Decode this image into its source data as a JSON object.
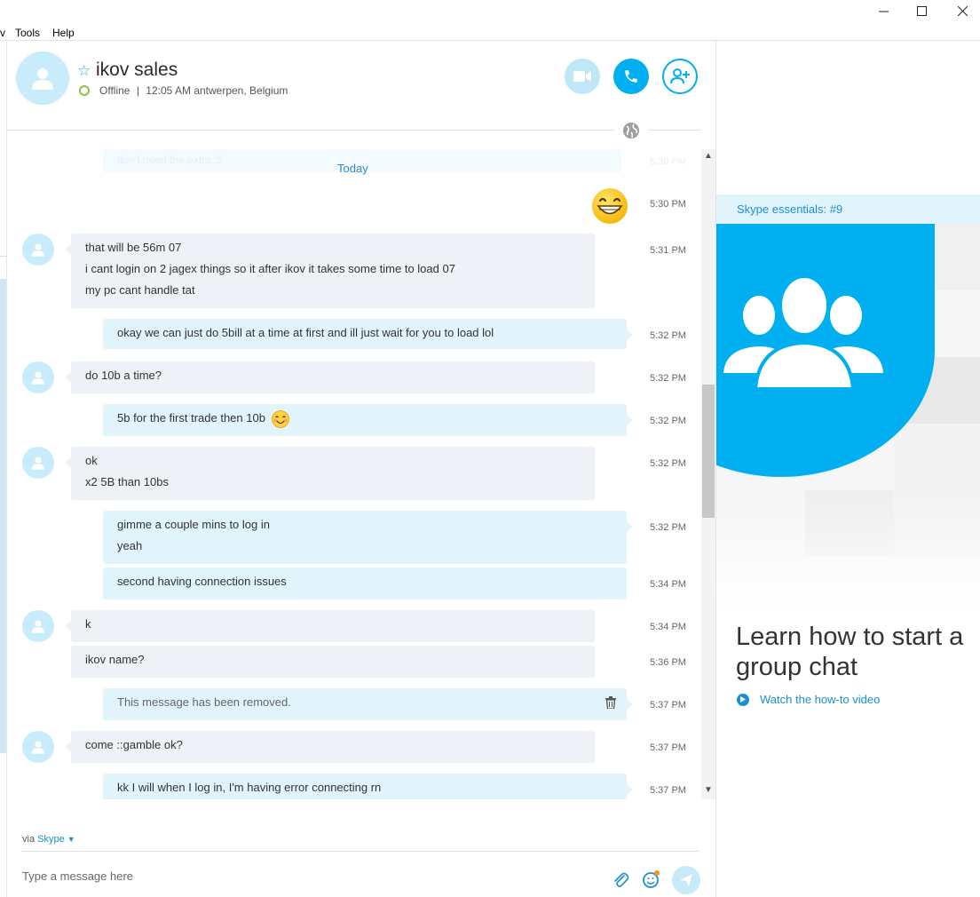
{
  "window": {
    "menu": [
      "v",
      "Tools",
      "Help"
    ],
    "controls": [
      "minimize",
      "maximize",
      "close"
    ]
  },
  "header": {
    "contact_name": "ikov sales",
    "status": "Offline",
    "status_separator": "|",
    "local_time": "12:05 AM antwerpen, Belgium",
    "icons": [
      "star-icon",
      "video-call-icon",
      "phone-icon",
      "add-people-icon",
      "globe-icon"
    ]
  },
  "chat": {
    "ghost_message": "don't need the extra .5",
    "ghost_time": "5:30 PM",
    "date_separator": "Today",
    "messages": [
      {
        "dir": "out",
        "emoji": "grin",
        "time": "5:30 PM"
      },
      {
        "dir": "in",
        "lines": [
          "that will be 56m 07",
          "i cant login on 2 jagex things so it after ikov it takes some time to load 07",
          "my pc cant handle tat"
        ],
        "time": "5:31 PM"
      },
      {
        "dir": "out",
        "lines": [
          "okay we can just do 5bill at a time at first and ill just wait for you to load lol"
        ],
        "time": "5:32 PM"
      },
      {
        "dir": "in",
        "lines": [
          "do 10b a time?"
        ],
        "time": "5:32 PM"
      },
      {
        "dir": "out",
        "lines": [
          "5b for the first trade then 10b"
        ],
        "emoji": "blush",
        "time": "5:32 PM"
      },
      {
        "dir": "in",
        "lines": [
          "ok",
          "x2 5B than 10bs"
        ],
        "time": "5:32 PM"
      },
      {
        "dir": "out",
        "lines": [
          "gimme a couple mins to log in",
          "yeah"
        ],
        "time": "5:32 PM"
      },
      {
        "dir": "out",
        "lines": [
          "second having connection issues"
        ],
        "time": "5:34 PM"
      },
      {
        "dir": "in",
        "lines": [
          "k"
        ],
        "time": "5:34 PM"
      },
      {
        "dir": "in",
        "lines": [
          "ikov name?"
        ],
        "time": "5:36 PM"
      },
      {
        "dir": "out",
        "lines": [
          "This message has been removed."
        ],
        "removed": true,
        "time": "5:37 PM"
      },
      {
        "dir": "in",
        "lines": [
          "come ::gamble ok?"
        ],
        "time": "5:37 PM"
      },
      {
        "dir": "out",
        "lines": [
          "kk I will when I log in, I'm having error connecting rn"
        ],
        "time": "5:37 PM"
      }
    ]
  },
  "composer": {
    "via_prefix": "via",
    "via_service": "Skype",
    "placeholder": "Type a message here",
    "icons": [
      "paperclip-icon",
      "emoticon-icon",
      "send-icon"
    ]
  },
  "side_panel": {
    "essentials": "Skype essentials: #9",
    "headline": "Learn how to start a group chat",
    "link": "Watch the how-to video",
    "colors": {
      "accent": "#00aff0",
      "link": "#1a8fd6",
      "bar": "#e1f4fc"
    }
  }
}
